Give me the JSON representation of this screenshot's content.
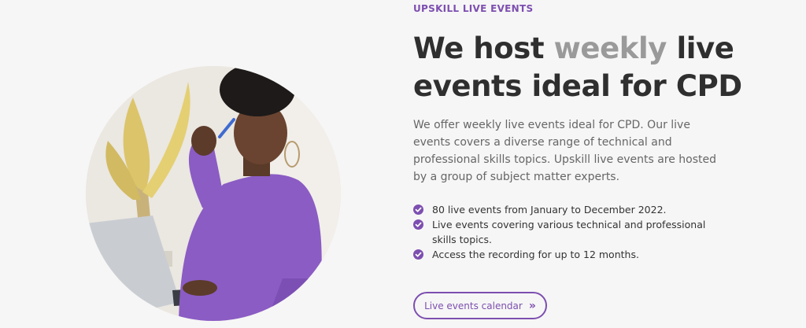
{
  "hero": {
    "eyebrow": "UPSKILL LIVE EVENTS",
    "title_before": "We host ",
    "title_highlight": "weekly",
    "title_after": " live events ideal for CPD",
    "description": "We offer weekly live events ideal for CPD. Our live events covers a diverse range of technical and professional skills topics. Upskill live events are hosted by a group of subject matter experts.",
    "features": [
      "80 live events from January to December 2022.",
      "Live events covering various technical and professional skills topics.",
      "Access the recording for up to 12 months."
    ],
    "cta_label": "Live events calendar",
    "cta_icon": "double-chevron-right-icon",
    "feature_icon": "check-circle-icon"
  },
  "colors": {
    "accent": "#7d4fb0",
    "heading": "#2f2f2f",
    "highlight": "#9a9a9a",
    "body_text": "#666666",
    "background": "#f6f6f6"
  }
}
